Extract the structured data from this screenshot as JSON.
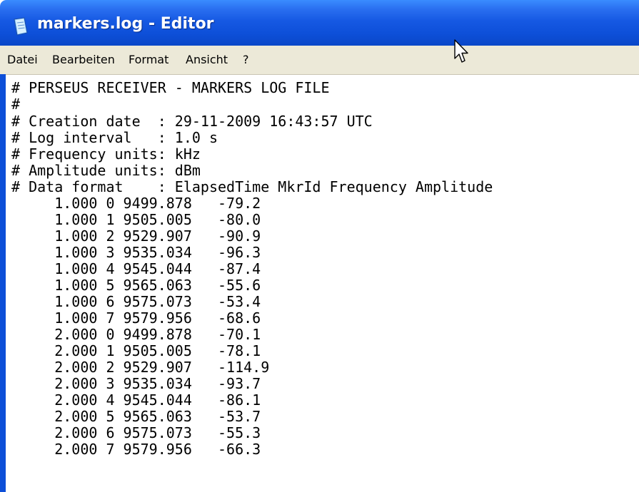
{
  "window": {
    "title": "markers.log - Editor",
    "app_icon": "notepad-icon",
    "titlebar_color": "#0d4fd8",
    "menubar_color": "#ece9d8"
  },
  "menu": {
    "items": [
      {
        "label": "Datei"
      },
      {
        "label": "Bearbeiten"
      },
      {
        "label": "Format"
      },
      {
        "label": "Ansicht"
      },
      {
        "label": "?"
      }
    ]
  },
  "editor": {
    "lines": [
      "# PERSEUS RECEIVER - MARKERS LOG FILE",
      "#",
      "# Creation date  : 29-11-2009 16:43:57 UTC",
      "# Log interval   : 1.0 s",
      "# Frequency units: kHz",
      "# Amplitude units: dBm",
      "# Data format    : ElapsedTime MkrId Frequency Amplitude",
      "     1.000 0 9499.878   -79.2",
      "     1.000 1 9505.005   -80.0",
      "     1.000 2 9529.907   -90.9",
      "     1.000 3 9535.034   -96.3",
      "     1.000 4 9545.044   -87.4",
      "     1.000 5 9565.063   -55.6",
      "     1.000 6 9575.073   -53.4",
      "     1.000 7 9579.956   -68.6",
      "     2.000 0 9499.878   -70.1",
      "     2.000 1 9505.005   -78.1",
      "     2.000 2 9529.907   -114.9",
      "     2.000 3 9535.034   -93.7",
      "     2.000 4 9545.044   -86.1",
      "     2.000 5 9565.063   -53.7",
      "     2.000 6 9575.073   -55.3",
      "     2.000 7 9579.956   -66.3"
    ]
  },
  "pointer": {
    "icon": "mouse-pointer-icon"
  }
}
